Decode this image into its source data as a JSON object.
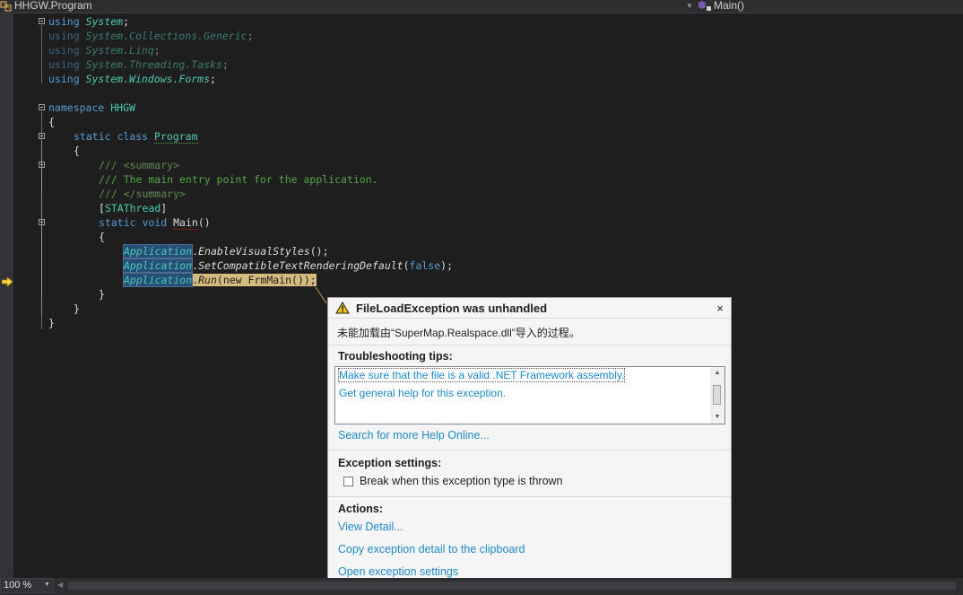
{
  "nav": {
    "class_label": "HHGW.Program",
    "member_label": "Main()"
  },
  "code": {
    "using1_kw": "using",
    "using1_ns": "System",
    "using2_kw": "using",
    "using2_ns": "System.Collections.Generic",
    "using3_kw": "using",
    "using3_ns": "System.Linq",
    "using4_kw": "using",
    "using4_ns": "System.Threading.Tasks",
    "using5_kw": "using",
    "using5_ns": "System.Windows.Forms",
    "semicolon": ";",
    "ns_kw": "namespace",
    "ns_name": "HHGW",
    "open_brace": "{",
    "close_brace": "}",
    "class_mods": "static class",
    "class_name": "Program",
    "doc1": "/// <summary>",
    "doc2": "/// The main entry point for the application.",
    "doc3": "/// </summary>",
    "attr_open": "[",
    "attr_name": "STAThread",
    "attr_close": "]",
    "main_mods": "static void",
    "main_name": "Main",
    "main_parens": "()",
    "app": "Application",
    "dot": ".",
    "m1": "EnableVisualStyles",
    "m1_tail": "();",
    "m2": "SetCompatibleTextRenderingDefault",
    "m2_open": "(",
    "m2_arg": "false",
    "m2_tail": ");",
    "m3": "Run",
    "m3_open": "(",
    "m3_new": "new",
    "m3_type": "FrmMain",
    "m3_tail": "());"
  },
  "exception": {
    "title": "FileLoadException was unhandled",
    "close_glyph": "×",
    "message": "未能加载由“SuperMap.Realspace.dll”导入的过程。",
    "tips_heading": "Troubleshooting tips:",
    "tips": [
      "Make sure that the file is a valid .NET Framework assembly.",
      "Get general help for this exception."
    ],
    "search_link": "Search for more Help Online...",
    "settings_heading": "Exception settings:",
    "break_label": "Break when this exception type is thrown",
    "break_checked": false,
    "actions_heading": "Actions:",
    "actions": [
      "View Detail...",
      "Copy exception detail to the clipboard",
      "Open exception settings"
    ]
  },
  "status": {
    "zoom": "100 %"
  },
  "colors": {
    "editor_bg": "#1e1e1e",
    "keyword": "#569cd6",
    "type": "#4ec9b0",
    "comment": "#57a64a",
    "link": "#1e8ac6",
    "current_statement": "#d7ba7d"
  }
}
